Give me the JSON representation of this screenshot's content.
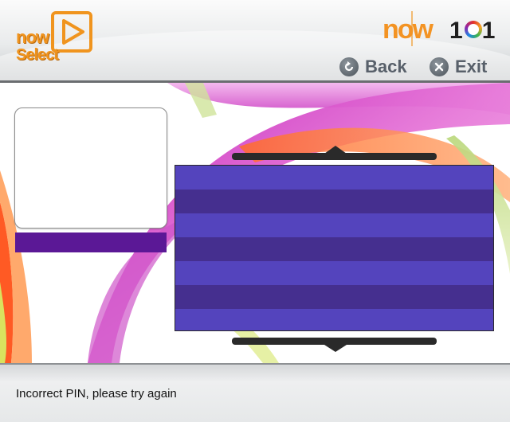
{
  "header": {
    "brand_select": {
      "line1": "now",
      "line2": "Select",
      "icon": "play-icon"
    },
    "brand_channel": {
      "word": "now",
      "number_prefix": "1",
      "number_suffix": "1",
      "icon": "ring-icon"
    },
    "nav": {
      "back": {
        "label": "Back",
        "icon": "back-circle-icon"
      },
      "exit": {
        "label": "Exit",
        "icon": "close-circle-icon"
      }
    }
  },
  "colors": {
    "accent_orange": "#f0941e",
    "title_bar": "#5b1896",
    "list_row_light": "#5444bd",
    "list_row_dark": "#452f8f"
  },
  "list": {
    "rows": [
      "",
      "",
      "",
      "",
      "",
      "",
      ""
    ]
  },
  "footer": {
    "message": "Incorrect PIN, please try again"
  }
}
